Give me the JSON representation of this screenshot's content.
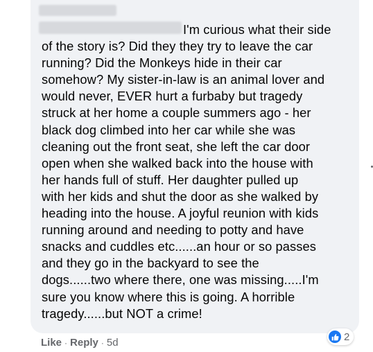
{
  "comment": {
    "lines": [
      "I'm curious what their side",
      "of the story is? Did they they try to leave the car",
      "running? Did the Monkeys hide in their car",
      "somehow? My sister-in-law is an animal lover and",
      "would never, EVER hurt a furbaby but tragedy",
      "struck at her home a couple summers ago - her",
      "black dog climbed into her car while she was",
      "cleaning out the front seat, she left the car door",
      "open when she walked back into the house with",
      "her hands full of stuff. Her daughter pulled up",
      "with her kids and shut the door as she walked by",
      "heading into the house. A joyful reunion with kids",
      "running around and needing to potty and have",
      "snacks and cuddles etc......an hour or so passes",
      "and they go in the backyard to see the",
      "dogs......two where there, one was missing.....I'm",
      "sure you know where this is going. A horrible",
      "tragedy......but NOT a crime!"
    ]
  },
  "reactions": {
    "icon": "thumbs-up-icon",
    "count": "2",
    "color": "#1877f2"
  },
  "actions": {
    "like_label": "Like",
    "separator": "·",
    "reply_label": "Reply",
    "time": "5d"
  },
  "colors": {
    "bubble": "#f0f2f5",
    "text": "#050505",
    "meta": "#65676b"
  }
}
